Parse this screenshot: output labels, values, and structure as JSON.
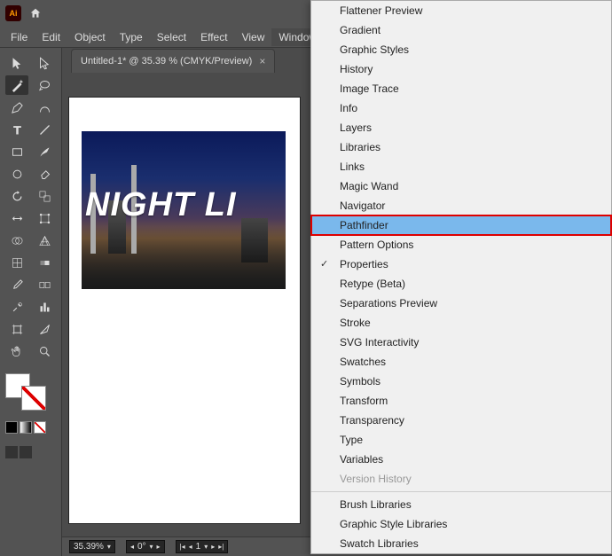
{
  "app": {
    "logo_text": "Ai"
  },
  "menubar": [
    "File",
    "Edit",
    "Object",
    "Type",
    "Select",
    "Effect",
    "View",
    "Window"
  ],
  "tab": {
    "title": "Untitled-1* @ 35.39 % (CMYK/Preview)"
  },
  "canvas": {
    "text": "NIGHT LI"
  },
  "statusbar": {
    "zoom": "35.39%",
    "rotate": "0°",
    "page": "1"
  },
  "window_menu": {
    "items": [
      {
        "label": "Flattener Preview"
      },
      {
        "label": "Gradient"
      },
      {
        "label": "Graphic Styles"
      },
      {
        "label": "History"
      },
      {
        "label": "Image Trace"
      },
      {
        "label": "Info"
      },
      {
        "label": "Layers"
      },
      {
        "label": "Libraries"
      },
      {
        "label": "Links"
      },
      {
        "label": "Magic Wand"
      },
      {
        "label": "Navigator"
      },
      {
        "label": "Pathfinder",
        "highlighted": true
      },
      {
        "label": "Pattern Options"
      },
      {
        "label": "Properties",
        "checked": true
      },
      {
        "label": "Retype (Beta)"
      },
      {
        "label": "Separations Preview"
      },
      {
        "label": "Stroke"
      },
      {
        "label": "SVG Interactivity"
      },
      {
        "label": "Swatches"
      },
      {
        "label": "Symbols"
      },
      {
        "label": "Transform"
      },
      {
        "label": "Transparency"
      },
      {
        "label": "Type"
      },
      {
        "label": "Variables"
      },
      {
        "label": "Version History",
        "disabled": true
      },
      {
        "separator": true
      },
      {
        "label": "Brush Libraries"
      },
      {
        "label": "Graphic Style Libraries"
      },
      {
        "label": "Swatch Libraries"
      }
    ]
  }
}
